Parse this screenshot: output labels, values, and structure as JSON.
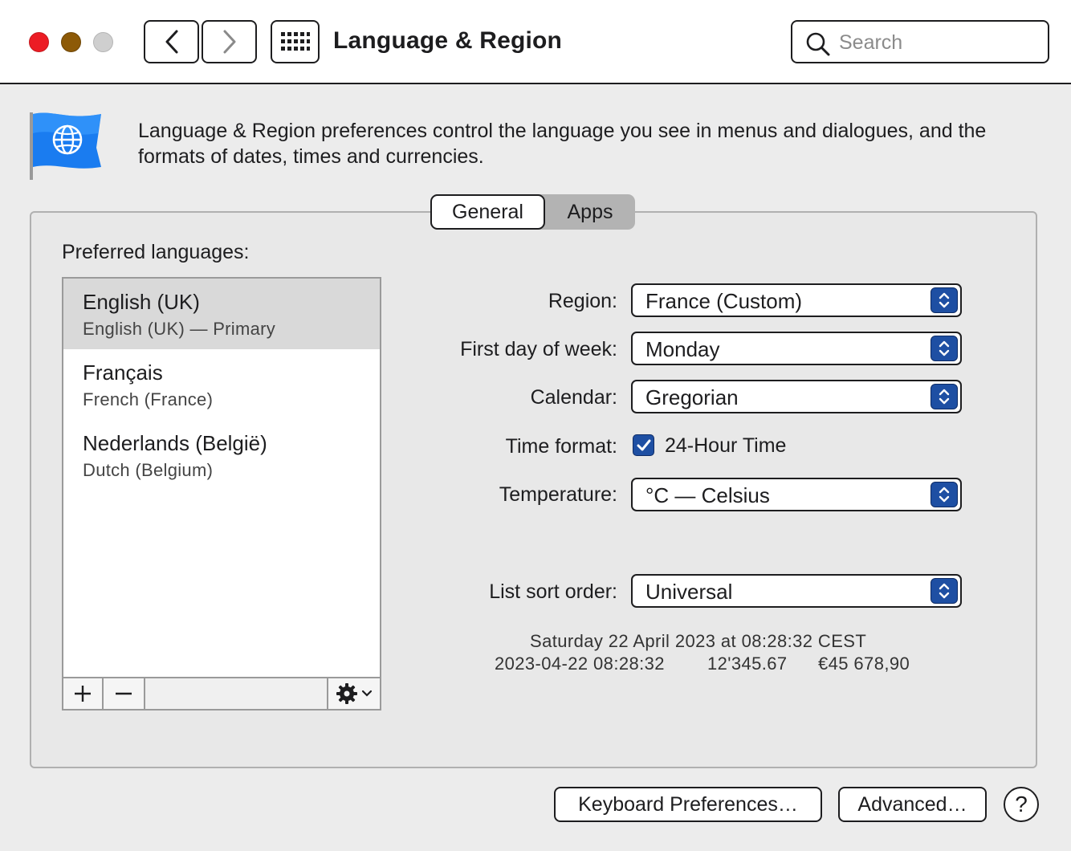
{
  "window": {
    "title": "Language & Region",
    "search_placeholder": "Search"
  },
  "header": {
    "description": "Language & Region preferences control the language you see in menus and dialogues, and the formats of dates, times and currencies."
  },
  "tabs": [
    {
      "label": "General",
      "active": true
    },
    {
      "label": "Apps",
      "active": false
    }
  ],
  "languages": {
    "label": "Preferred languages:",
    "items": [
      {
        "name": "English (UK)",
        "sub": "English (UK) — Primary",
        "selected": true
      },
      {
        "name": "Français",
        "sub": "French (France)",
        "selected": false
      },
      {
        "name": "Nederlands (België)",
        "sub": "Dutch (Belgium)",
        "selected": false
      }
    ],
    "toolbar": {
      "add": "+",
      "remove": "—"
    }
  },
  "form": {
    "region": {
      "label": "Region:",
      "value": "France (Custom)"
    },
    "first_day": {
      "label": "First day of week:",
      "value": "Monday"
    },
    "calendar": {
      "label": "Calendar:",
      "value": "Gregorian"
    },
    "time_format": {
      "label": "Time format:",
      "checkbox_label": "24-Hour Time",
      "checked": true
    },
    "temperature": {
      "label": "Temperature:",
      "value": "°C — Celsius"
    },
    "sort_order": {
      "label": "List sort order:",
      "value": "Universal"
    }
  },
  "samples": {
    "long_date": "Saturday 22 April 2023 at 08:28:32 CEST",
    "short_date": "2023-04-22 08:28:32",
    "number": "12'345.67",
    "currency": "€45 678,90"
  },
  "buttons": {
    "keyboard": "Keyboard Preferences…",
    "advanced": "Advanced…",
    "help": "?"
  },
  "colors": {
    "accent": "#1e4fa3",
    "close": "#ec1c24",
    "minimize": "#8d5a07",
    "zoom": "#cfcfcf"
  }
}
